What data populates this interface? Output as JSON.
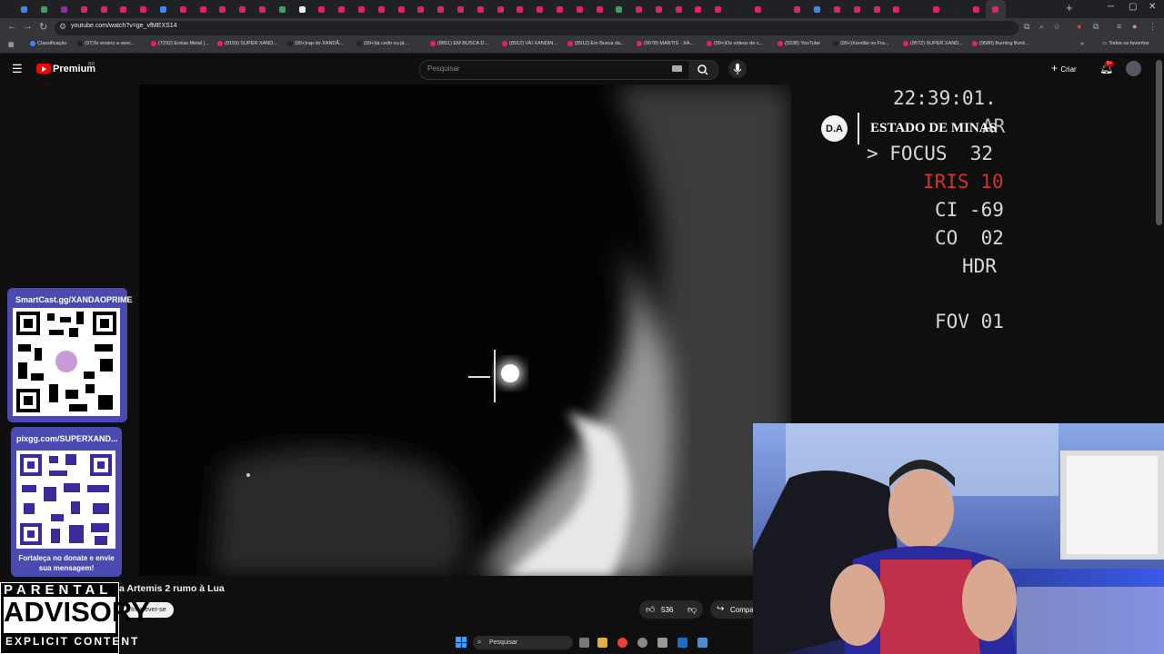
{
  "browser": {
    "url": "youtube.com/watch?v=ge_vfMEXS14",
    "bookmarks": [
      "Classificação",
      "(97)Te ensino a venc...",
      "(7292) Enéas Metal |...",
      "(8159) SUPER XAND...",
      "(99+)rap do XANDÃ...",
      "(99+)tá cedo ou já...",
      "(8851) EM BUSCA D...",
      "(8912) VAI XANDIN...",
      "(8912) Em Busca da...",
      "(9078) MANTIS - XA...",
      "(99+)Os vídeos de c...",
      "(9338) YouTube",
      "(99+)Xandão vs Fra...",
      "(9572) SUPER XAND...",
      "(9580) Burning Bord..."
    ],
    "all_bookmarks": "Todos os favoritos"
  },
  "youtube": {
    "brand": "Premium",
    "country": "BR",
    "search_placeholder": "Pesquisar",
    "create_label": "Criar",
    "notifications": "9+"
  },
  "video": {
    "hud": {
      "time": "22:39:01.",
      "partial": "AR",
      "focus": "> FOCUS  32",
      "iris": "IRIS 10",
      "ci": "CI -69",
      "co": "CO  02",
      "hdr": "HDR",
      "fov": "FOV 01"
    },
    "watermark_logo": "D.A",
    "watermark_name": "ESTADO DE MINAS",
    "title": "a Artemis 2 rumo à Lua",
    "subscribe_label": "Inscrever-se",
    "likes": "536",
    "share_label": "Compa"
  },
  "overlay": {
    "qr1_title": "SmartCast.gg/XANDAOPRIME",
    "qr2_title": "pixgg.com/SUPERXAND...",
    "qr2_caption": "Fortaleça no donate e envie sua mensagem!",
    "advisory_line1": "PARENTAL",
    "advisory_line2": "ADVISORY",
    "advisory_line3": "EXPLICIT CONTENT"
  },
  "taskbar": {
    "search_label": "Pesquisar"
  },
  "colors": {
    "accent_red": "#ff0000",
    "qr_panel": "#4a4ab0",
    "hud_iris": "#cc3333"
  }
}
